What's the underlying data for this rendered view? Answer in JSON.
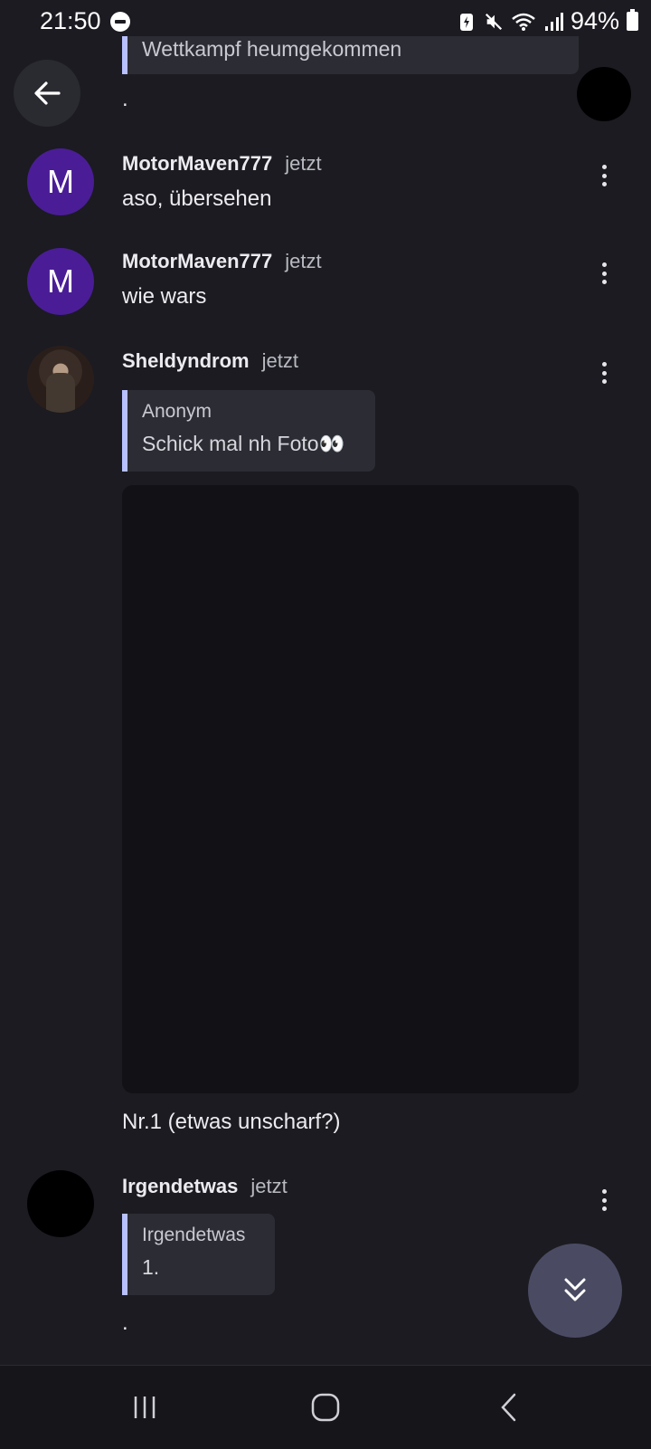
{
  "status_bar": {
    "time": "21:50",
    "battery": "94%"
  },
  "prev_quote_text": "Wettkampf heumgekommen",
  "prev_message_text": ".",
  "messages": [
    {
      "avatar_letter": "M",
      "author": "MotorMaven777",
      "time": "jetzt",
      "text": "aso, übersehen"
    },
    {
      "avatar_letter": "M",
      "author": "MotorMaven777",
      "time": "jetzt",
      "text": "wie wars"
    },
    {
      "author": "Sheldyndrom",
      "time": "jetzt",
      "reply": {
        "author": "Anonym",
        "text": "Schick mal nh Foto👀"
      },
      "caption": "Nr.1 (etwas unscharf?)"
    },
    {
      "author": "Irgendetwas",
      "time": "jetzt",
      "reply": {
        "author": "Irgendetwas",
        "text": "1."
      },
      "text": "."
    }
  ],
  "colors": {
    "background": "#1b1b21",
    "accent": "#b8c0ff",
    "avatar": "#4a1d96",
    "fab": "#4a4b63"
  },
  "icons": {
    "back": "arrow-left-icon",
    "more": "more-vert-icon",
    "scroll": "double-chevron-down-icon",
    "nav": [
      "recents-icon",
      "home-icon",
      "back-nav-icon"
    ]
  }
}
